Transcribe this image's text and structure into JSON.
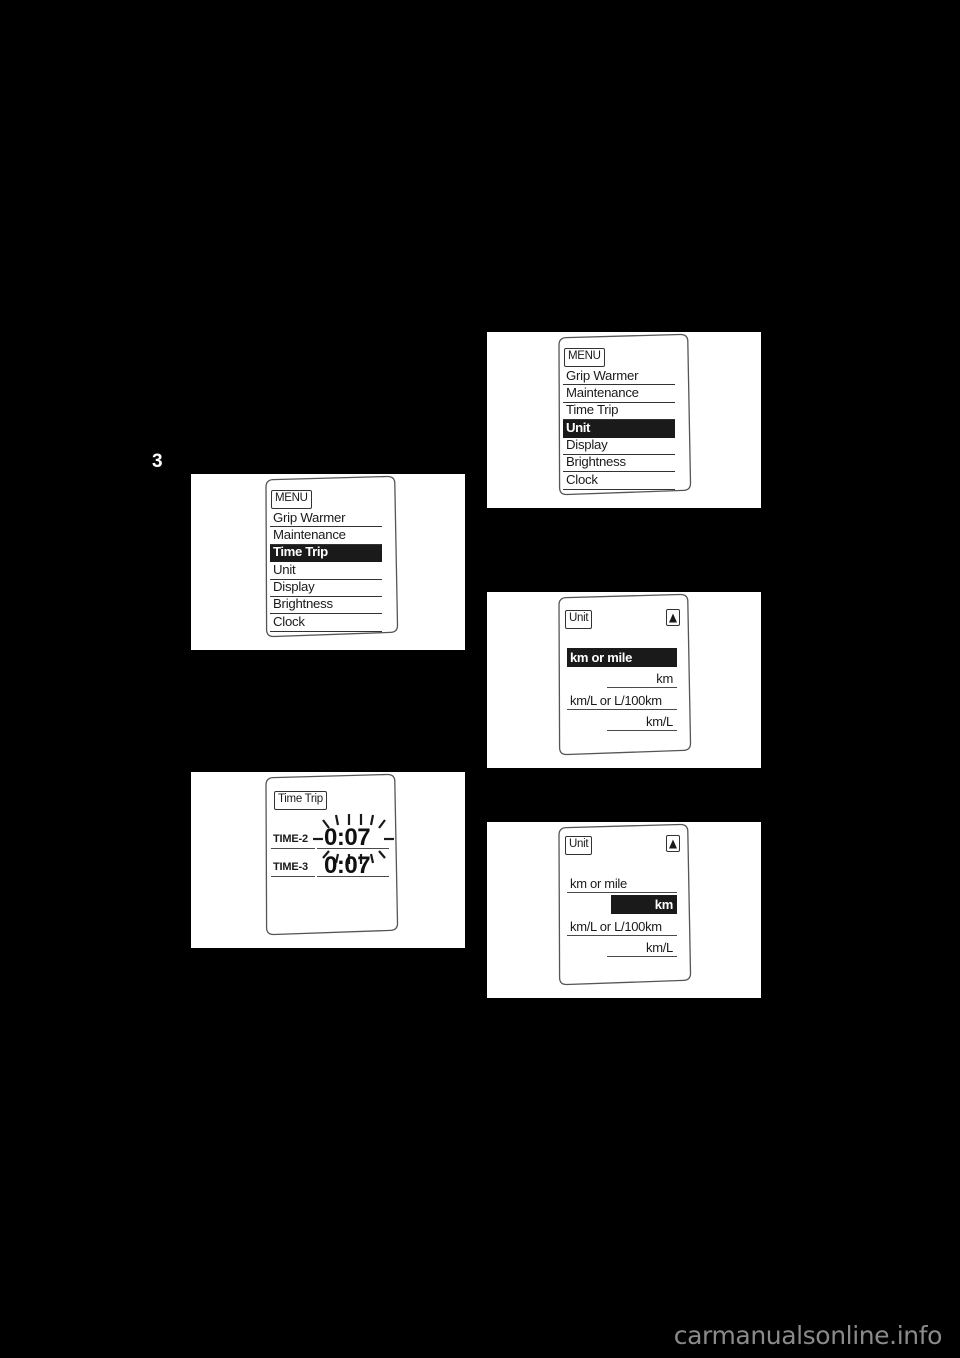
{
  "page": {
    "number": "3",
    "background_color": "#000000",
    "watermark": "carmanualsonline.info"
  },
  "figures": [
    {
      "id": "fig-menu-timetrip",
      "name": "menu-screen-time-trip-selected",
      "screen_tag": "MENU",
      "items": [
        {
          "label": "Grip Warmer",
          "selected": false
        },
        {
          "label": "Maintenance",
          "selected": false
        },
        {
          "label": "Time Trip",
          "selected": true
        },
        {
          "label": "Unit",
          "selected": false
        },
        {
          "label": "Display",
          "selected": false
        },
        {
          "label": "Brightness",
          "selected": false
        },
        {
          "label": "Clock",
          "selected": false
        }
      ]
    },
    {
      "id": "fig-timetrip",
      "name": "time-trip-screen",
      "screen_tag": "Time Trip",
      "rows": [
        {
          "label": "TIME-2",
          "value": "0:07",
          "blinking": true
        },
        {
          "label": "TIME-3",
          "value": "0:07",
          "blinking": false
        }
      ]
    },
    {
      "id": "fig-menu-unit",
      "name": "menu-screen-unit-selected",
      "screen_tag": "MENU",
      "items": [
        {
          "label": "Grip Warmer",
          "selected": false
        },
        {
          "label": "Maintenance",
          "selected": false
        },
        {
          "label": "Time Trip",
          "selected": false
        },
        {
          "label": "Unit",
          "selected": true
        },
        {
          "label": "Display",
          "selected": false
        },
        {
          "label": "Brightness",
          "selected": false
        },
        {
          "label": "Clock",
          "selected": false
        }
      ]
    },
    {
      "id": "fig-unit-a",
      "name": "unit-screen-km-or-mile-selected",
      "screen_tag": "Unit",
      "arrow_icon": "up-triangle-icon",
      "rows": [
        {
          "label": "km or mile",
          "align": "left",
          "selected": true
        },
        {
          "label": "km",
          "align": "right",
          "selected": false
        },
        {
          "label": "km/L or L/100km",
          "align": "left",
          "selected": false
        },
        {
          "label": "km/L",
          "align": "right",
          "selected": false
        }
      ]
    },
    {
      "id": "fig-unit-b",
      "name": "unit-screen-km-value-selected",
      "screen_tag": "Unit",
      "arrow_icon": "up-triangle-icon",
      "rows": [
        {
          "label": "km or mile",
          "align": "left",
          "selected": false
        },
        {
          "label": "km",
          "align": "right",
          "selected": true
        },
        {
          "label": "km/L or L/100km",
          "align": "left",
          "selected": false
        },
        {
          "label": "km/L",
          "align": "right",
          "selected": false
        }
      ]
    }
  ],
  "colors": {
    "page_bg": "#000000",
    "panel_bg": "#ffffff",
    "ink": "#1a1a1a",
    "highlight_bg": "#1a1a1a",
    "highlight_fg": "#ffffff",
    "watermark": "#8a8a8a"
  }
}
